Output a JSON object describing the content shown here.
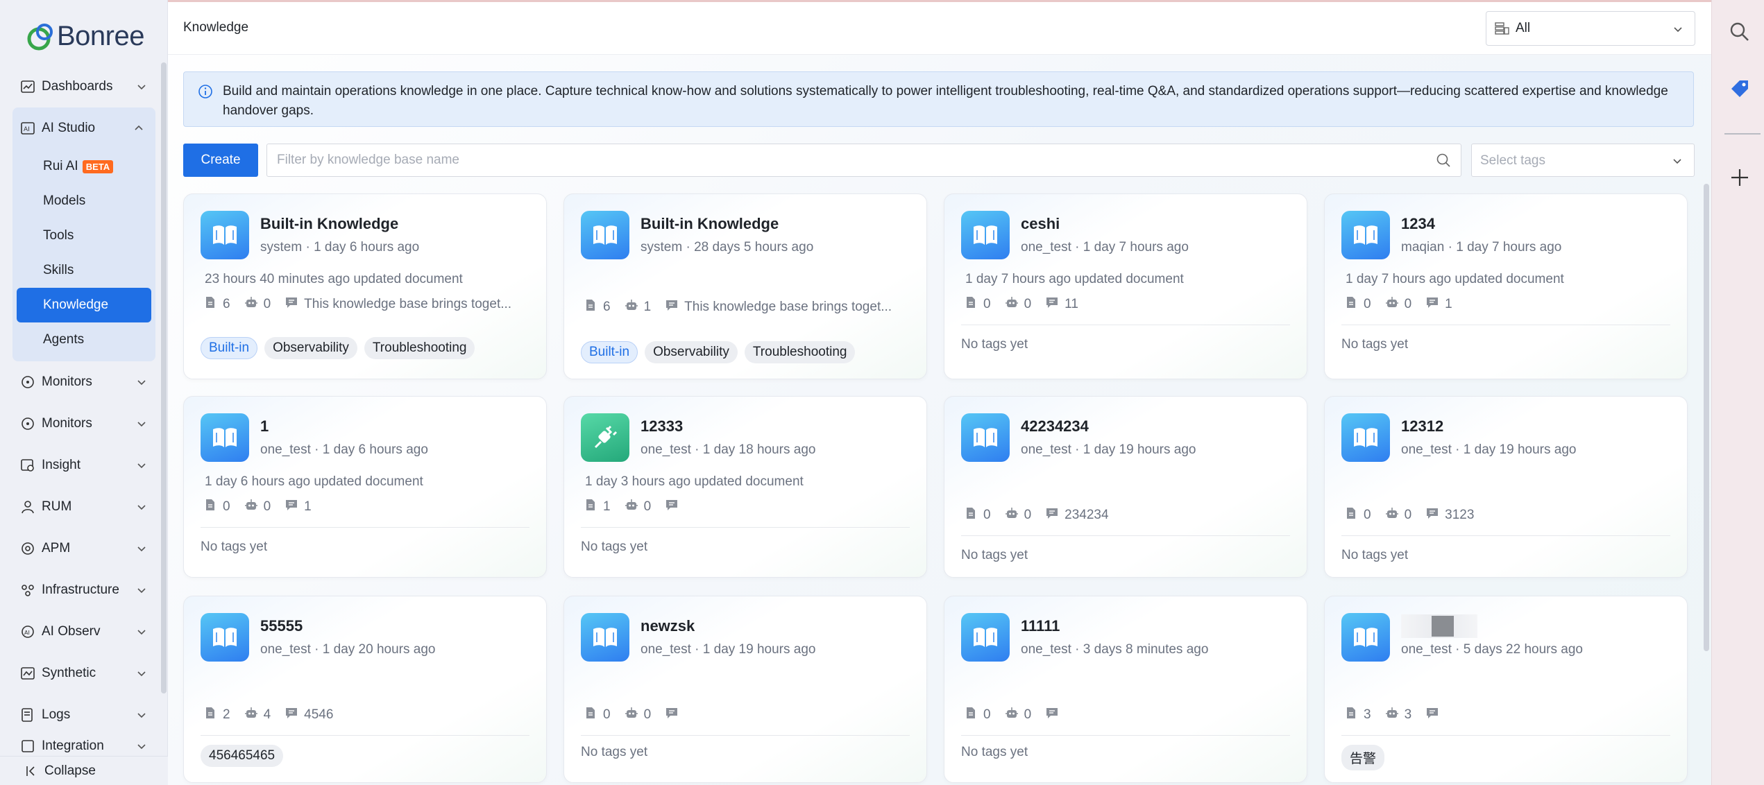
{
  "brand": {
    "name": "Bonree"
  },
  "sidebar": {
    "items": [
      {
        "label": "Dashboards",
        "icon": "chart-line-icon"
      },
      {
        "label": "AI Studio",
        "icon": "ai-icon",
        "expanded": true,
        "children": [
          {
            "label": "Rui AI",
            "badge": "BETA"
          },
          {
            "label": "Models"
          },
          {
            "label": "Tools"
          },
          {
            "label": "Skills"
          },
          {
            "label": "Knowledge",
            "active": true
          },
          {
            "label": "Agents"
          }
        ]
      },
      {
        "label": "Monitors",
        "icon": "monitor-icon"
      },
      {
        "label": "Monitors",
        "icon": "monitor-icon"
      },
      {
        "label": "Insight",
        "icon": "insight-icon"
      },
      {
        "label": "RUM",
        "icon": "user-icon"
      },
      {
        "label": "APM",
        "icon": "apm-icon"
      },
      {
        "label": "Infrastructure",
        "icon": "infrastructure-icon"
      },
      {
        "label": "AI Observ",
        "icon": "ai-observ-icon"
      },
      {
        "label": "Synthetic",
        "icon": "synthetic-icon"
      },
      {
        "label": "Logs",
        "icon": "logs-icon"
      },
      {
        "label": "Integration",
        "icon": "integration-icon"
      }
    ],
    "collapse_label": "Collapse"
  },
  "header": {
    "title": "Knowledge",
    "scope_value": "All"
  },
  "banner": {
    "text": "Build and maintain operations knowledge in one place. Capture technical know-how and solutions systematically to power intelligent troubleshooting, real-time Q&A, and standardized operations support—reducing scattered expertise and knowledge handover gaps."
  },
  "toolbar": {
    "create_label": "Create",
    "search_placeholder": "Filter by knowledge base name",
    "tags_placeholder": "Select tags"
  },
  "no_tags_label": "No tags yet",
  "cards": [
    {
      "name": "Built-in Knowledge",
      "owner": "system",
      "time": "1 day 6 hours ago",
      "updated": "23 hours 40 minutes ago updated document",
      "docs": "6",
      "agents": "0",
      "desc": "This knowledge base brings toget...",
      "tags": [
        "Built-in",
        "Observability",
        "Troubleshooting"
      ],
      "icon": "book-icon",
      "color": "blue"
    },
    {
      "name": "Built-in Knowledge",
      "owner": "system",
      "time": "28 days 5 hours ago",
      "updated": "",
      "docs": "6",
      "agents": "1",
      "desc": "This knowledge base brings toget...",
      "tags": [
        "Built-in",
        "Observability",
        "Troubleshooting"
      ],
      "icon": "book-icon",
      "color": "blue"
    },
    {
      "name": "ceshi",
      "owner": "one_test",
      "time": "1 day 7 hours ago",
      "updated": "1 day 7 hours ago updated document",
      "docs": "0",
      "agents": "0",
      "desc": "11",
      "tags": [],
      "icon": "book-icon",
      "color": "blue"
    },
    {
      "name": "1234",
      "owner": "maqian",
      "time": "1 day 7 hours ago",
      "updated": "1 day 7 hours ago updated document",
      "docs": "0",
      "agents": "0",
      "desc": "1",
      "tags": [],
      "icon": "book-icon",
      "color": "blue"
    },
    {
      "name": "1",
      "owner": "one_test",
      "time": "1 day 6 hours ago",
      "updated": "1 day 6 hours ago updated document",
      "docs": "0",
      "agents": "0",
      "desc": "1",
      "tags": [],
      "icon": "book-icon",
      "color": "blue"
    },
    {
      "name": "12333",
      "owner": "one_test",
      "time": "1 day 18 hours ago",
      "updated": "1 day 3 hours ago updated document",
      "docs": "1",
      "agents": "0",
      "desc": "",
      "tags": [],
      "icon": "plug-icon",
      "color": "green"
    },
    {
      "name": "42234234",
      "owner": "one_test",
      "time": "1 day 19 hours ago",
      "updated": "",
      "docs": "0",
      "agents": "0",
      "desc": "234234",
      "tags": [],
      "icon": "book-icon",
      "color": "blue"
    },
    {
      "name": "12312",
      "owner": "one_test",
      "time": "1 day 19 hours ago",
      "updated": "",
      "docs": "0",
      "agents": "0",
      "desc": "3123",
      "tags": [],
      "icon": "book-icon",
      "color": "blue"
    },
    {
      "name": "55555",
      "owner": "one_test",
      "time": "1 day 20 hours ago",
      "updated": "",
      "docs": "2",
      "agents": "4",
      "desc": "4546",
      "tags": [
        "456465465"
      ],
      "icon": "book-icon",
      "color": "blue"
    },
    {
      "name": "newzsk",
      "owner": "one_test",
      "time": "1 day 19 hours ago",
      "updated": "",
      "docs": "0",
      "agents": "0",
      "desc": "",
      "tags": [],
      "icon": "book-icon",
      "color": "blue"
    },
    {
      "name": "11111",
      "owner": "one_test",
      "time": "3 days 8 minutes ago",
      "updated": "",
      "docs": "0",
      "agents": "0",
      "desc": "",
      "tags": [],
      "icon": "book-icon",
      "color": "blue"
    },
    {
      "name": "",
      "owner": "one_test",
      "time": "5 days 22 hours ago",
      "updated": "",
      "docs": "3",
      "agents": "3",
      "desc": "",
      "tags": [
        "告警"
      ],
      "icon": "book-icon",
      "color": "blue",
      "name_redacted": true
    }
  ],
  "right_rail": {
    "items": [
      "search-icon",
      "tag-icon",
      "plus-icon"
    ]
  }
}
